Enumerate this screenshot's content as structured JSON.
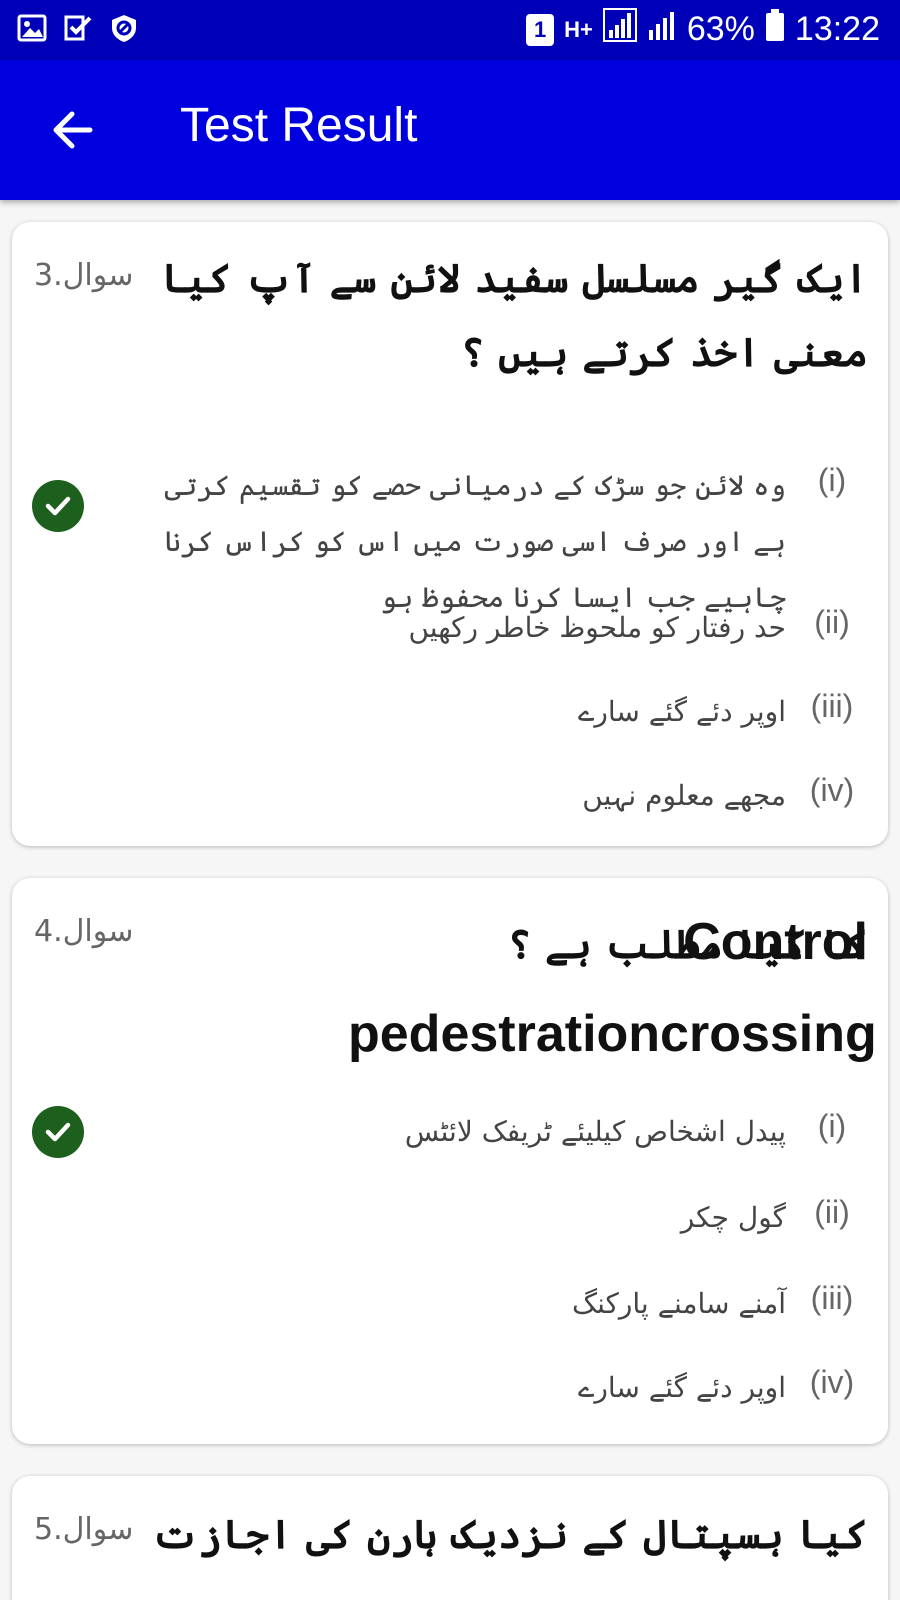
{
  "status_bar": {
    "notifications": [
      "image-icon",
      "check-list-icon",
      "shield-icon"
    ],
    "sim": "1",
    "network": "H+",
    "battery": "63%",
    "time": "13:22"
  },
  "app_bar": {
    "title": "Test Result"
  },
  "questions": [
    {
      "number": "3.سوال",
      "text": "ایک گیر مسلسل سفید لائن سے آپ کیا معنی اخذ کرتے ہیں ؟",
      "options": [
        {
          "label": "(i)",
          "text": "وہ لائن جو سڑک کے درمیانی حصے کو تقسیم کرتی ہے اور صرف اسی صورت میں اس کو کراس کرنا چاہیے جب ایسا کرنا محفوظ ہو"
        },
        {
          "label": "(ii)",
          "text": "حد رفتار کو ملحوظ خاطر رکھیں"
        },
        {
          "label": "(iii)",
          "text": "اوپر دئے گئے سارے"
        },
        {
          "label": "(iv)",
          "text": "مجھے معلوم نہیں"
        }
      ]
    },
    {
      "number": "4.سوال",
      "text": "Control pedestrationcrossing",
      "text_urdu": "کا کیا مطلب ہے ؟",
      "options": [
        {
          "label": "(i)",
          "text": "پیدل اشخاص کیلیئے ٹریفک لائٹس"
        },
        {
          "label": "(ii)",
          "text": "گول چکر"
        },
        {
          "label": "(iii)",
          "text": "آمنے سامنے پارکنگ"
        },
        {
          "label": "(iv)",
          "text": "اوپر دئے گئے سارے"
        }
      ]
    },
    {
      "number": "5.سوال",
      "text": "کیا ہسپتال کے نزدیک ہارن کی اجازت ہے"
    }
  ]
}
